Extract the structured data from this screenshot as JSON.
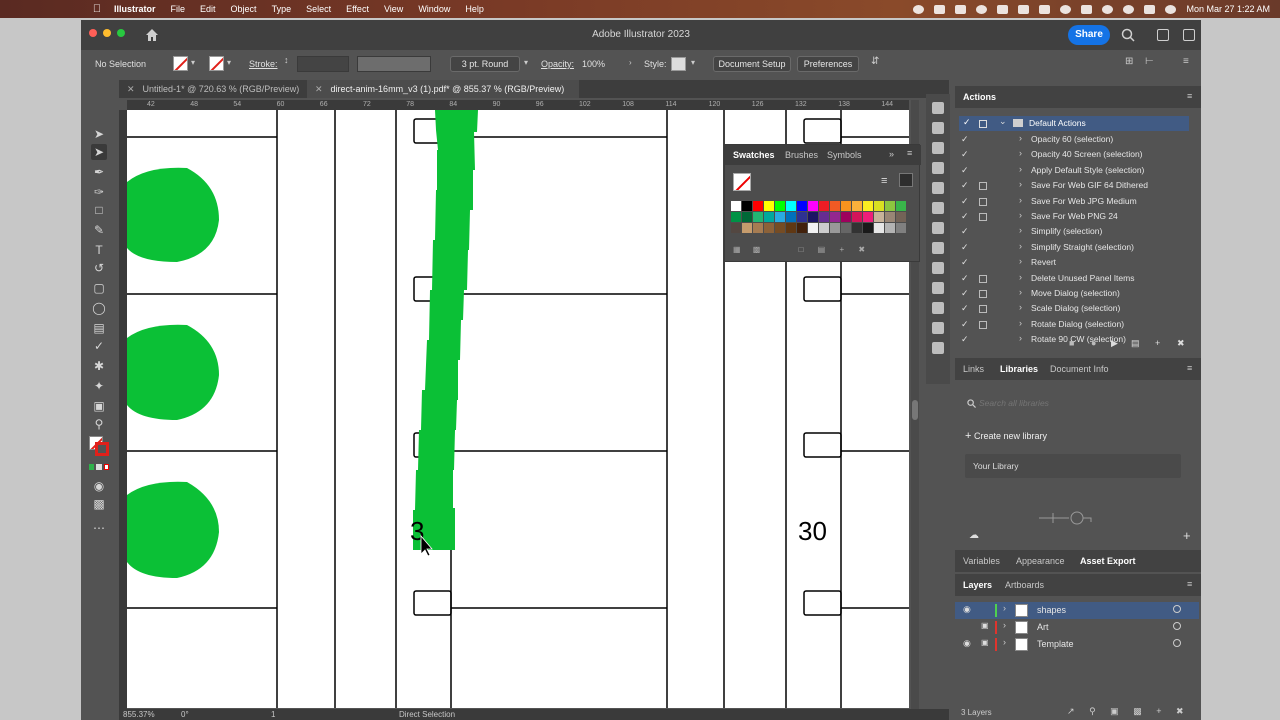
{
  "menubar": {
    "items": [
      "Illustrator",
      "File",
      "Edit",
      "Object",
      "Type",
      "Select",
      "Effect",
      "View",
      "Window",
      "Help"
    ],
    "datetime": "Mon Mar 27  1:22 AM"
  },
  "window": {
    "title": "Adobe Illustrator 2023",
    "share_label": "Share"
  },
  "control": {
    "selection": "No Selection",
    "stroke_label": "Stroke:",
    "brush": "3 pt. Round",
    "opacity_label": "Opacity:",
    "opacity_value": "100%",
    "style_label": "Style:",
    "doc_setup": "Document Setup",
    "preferences": "Preferences"
  },
  "tabs": [
    {
      "label": "Untitled-1* @ 720.63 % (RGB/Preview)"
    },
    {
      "label": "direct-anim-16mm_v3 (1).pdf* @ 855.37 % (RGB/Preview)"
    }
  ],
  "ruler": {
    "ticks": [
      "42",
      "48",
      "54",
      "60",
      "66",
      "72",
      "78",
      "84",
      "90",
      "96",
      "102",
      "108",
      "114",
      "120",
      "126",
      "132",
      "138",
      "144"
    ]
  },
  "canvas": {
    "frame_number": "30"
  },
  "statusbar": {
    "zoom": "855.37%",
    "rotation": "0°",
    "artboard": "1",
    "tool": "Direct Selection"
  },
  "swatches_panel": {
    "tabs": [
      "Swatches",
      "Brushes",
      "Symbols"
    ],
    "colors": [
      "#ffffff",
      "#000000",
      "#ff0000",
      "#ffff00",
      "#00ff00",
      "#00ffff",
      "#0000ff",
      "#ff00ff",
      "#ed1c24",
      "#f15a24",
      "#f7931e",
      "#fbb03b",
      "#fcee21",
      "#d9e021",
      "#8cc63f",
      "#39b54a",
      "#009245",
      "#006837",
      "#22b573",
      "#00a99d",
      "#29abe2",
      "#0071bc",
      "#2e3192",
      "#1b1464",
      "#662d91",
      "#93278f",
      "#9e005d",
      "#d4145a",
      "#ed1e79",
      "#c7b299",
      "#998675",
      "#736357",
      "#534741",
      "#c69c6d",
      "#a67c52",
      "#8c6239",
      "#754c24",
      "#603813",
      "#42210b",
      "#f2f2f2",
      "#cccccc",
      "#999999",
      "#666666",
      "#333333",
      "#1a1a1a",
      "#e6e6e6",
      "#b3b3b3",
      "#808080"
    ]
  },
  "actions_panel": {
    "title": "Actions",
    "set_name": "Default Actions",
    "items": [
      {
        "name": "Opacity 60 (selection)",
        "box": false
      },
      {
        "name": "Opacity 40 Screen (selection)",
        "box": false
      },
      {
        "name": "Apply Default Style (selection)",
        "box": false
      },
      {
        "name": "Save For Web GIF 64 Dithered",
        "box": true
      },
      {
        "name": "Save For Web JPG Medium",
        "box": true
      },
      {
        "name": "Save For Web PNG 24",
        "box": true
      },
      {
        "name": "Simplify (selection)",
        "box": false
      },
      {
        "name": "Simplify Straight (selection)",
        "box": false
      },
      {
        "name": "Revert",
        "box": false
      },
      {
        "name": "Delete Unused Panel Items",
        "box": true
      },
      {
        "name": "Move Dialog (selection)",
        "box": true
      },
      {
        "name": "Scale Dialog (selection)",
        "box": true
      },
      {
        "name": "Rotate Dialog (selection)",
        "box": true
      },
      {
        "name": "Rotate 90 CW (selection)",
        "box": false
      }
    ]
  },
  "libraries_panel": {
    "tabs": [
      "Links",
      "Libraries",
      "Document Info"
    ],
    "search_placeholder": "Search all libraries",
    "create_label": "Create new library",
    "library_name": "Your Library"
  },
  "mid_tabs": [
    "Variables",
    "Appearance",
    "Asset Export"
  ],
  "layers_panel": {
    "tabs": [
      "Layers",
      "Artboards"
    ],
    "layers": [
      {
        "name": "shapes",
        "color": "#4fd14f"
      },
      {
        "name": "Art",
        "color": "#e0342d"
      },
      {
        "name": "Template",
        "color": "#e0342d"
      }
    ],
    "count_label": "3 Layers"
  },
  "colors": {
    "accent": "#1473e6",
    "green": "#0bc036"
  }
}
